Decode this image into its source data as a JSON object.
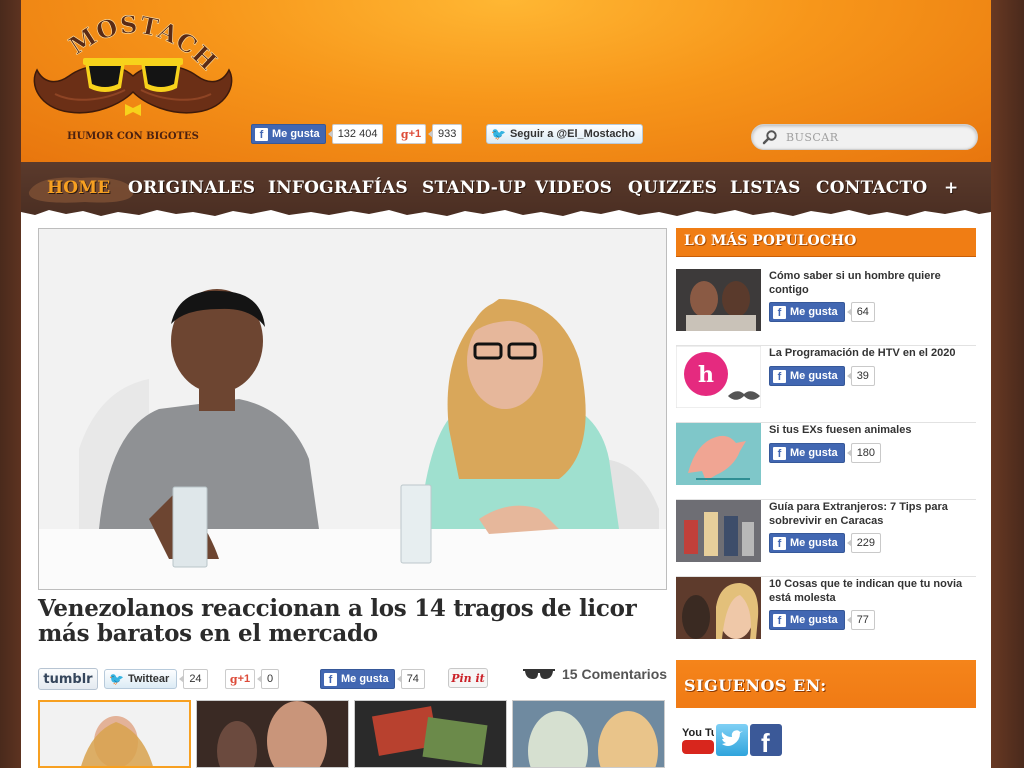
{
  "site": {
    "logo_title": "EL MOSTACHO",
    "logo_tagline": "HUMOR CON BIGOTES"
  },
  "header": {
    "fb_like_label": "Me gusta",
    "fb_like_count": "132 404",
    "gplus_label": "+1",
    "gplus_count": "933",
    "twitter_follow_label": "Seguir a @El_Mostacho",
    "search_placeholder": "BUSCAR"
  },
  "nav": {
    "items": [
      {
        "label": "HOME",
        "active": true
      },
      {
        "label": "ORIGINALES"
      },
      {
        "label": "INFOGRAFÍAS"
      },
      {
        "label": "STAND-UP"
      },
      {
        "label": "VIDEOS"
      },
      {
        "label": "QUIZZES"
      },
      {
        "label": "LISTAS"
      },
      {
        "label": "CONTACTO"
      },
      {
        "label": "+"
      }
    ]
  },
  "article": {
    "title": "Venezolanos reaccionan a los 14 tragos de licor más baratos en el mercado",
    "share": {
      "tumblr_label": "tumblr",
      "tweet_label": "Twittear",
      "tweet_count": "24",
      "gplus_label": "+1",
      "gplus_count": "0",
      "fb_label": "Me gusta",
      "fb_count": "74",
      "pinit_label": "Pin it",
      "comments_label": "15 Comentarios"
    }
  },
  "sidebar": {
    "popular_title": "LO MÁS POPULOCHO",
    "popular": [
      {
        "title": "Cómo saber si un hombre quiere contigo",
        "like_label": "Me gusta",
        "likes": "64"
      },
      {
        "title": "La Programación de HTV en el 2020",
        "like_label": "Me gusta",
        "likes": "39"
      },
      {
        "title": "Si tus EXs fuesen animales",
        "like_label": "Me gusta",
        "likes": "180"
      },
      {
        "title": "Guía para Extranjeros: 7 Tips para sobrevivir en Caracas",
        "like_label": "Me gusta",
        "likes": "229"
      },
      {
        "title": "10 Cosas que te indican que tu novia está molesta",
        "like_label": "Me gusta",
        "likes": "77"
      }
    ],
    "follow_title": "SIGUENOS EN:",
    "follow_icons": [
      "youtube-icon",
      "twitter-icon",
      "facebook-icon"
    ],
    "youtube_text": "You Tube"
  },
  "colors": {
    "orange": "#f07d14",
    "nav_brown": "#4a2e22",
    "facebook_blue": "#4267b2",
    "active_nav": "#f7a021"
  }
}
